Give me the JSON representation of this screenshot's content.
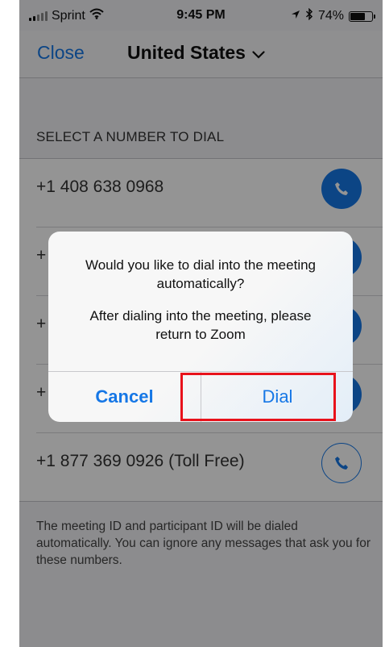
{
  "status_bar": {
    "carrier": "Sprint",
    "time": "9:45 PM",
    "battery_percent": "74%",
    "battery_level": 0.74,
    "icons": [
      "signal-icon",
      "wifi-icon",
      "location-icon",
      "bluetooth-icon",
      "battery-icon"
    ]
  },
  "nav": {
    "close_label": "Close",
    "country": "United States"
  },
  "section_header": "SELECT A NUMBER TO DIAL",
  "numbers": [
    {
      "text": "+1 408 638 0968",
      "icon": "phone-icon"
    },
    {
      "text": "+",
      "icon": "phone-icon"
    },
    {
      "text": "+",
      "icon": "phone-icon"
    },
    {
      "text": "+",
      "icon": "phone-icon"
    },
    {
      "text": "+1 877 369 0926 (Toll Free)",
      "icon": "phone-icon"
    }
  ],
  "footer_note": "The meeting ID and participant ID will be dialed automatically. You can ignore any messages that ask you for these numbers.",
  "alert": {
    "line1": "Would you like to dial into the meeting",
    "line2": "automatically?",
    "line3": "After dialing into the meeting, please",
    "line4": "return to Zoom",
    "cancel_label": "Cancel",
    "dial_label": "Dial"
  },
  "colors": {
    "accent": "#1677e6",
    "highlight": "#e8121b"
  }
}
